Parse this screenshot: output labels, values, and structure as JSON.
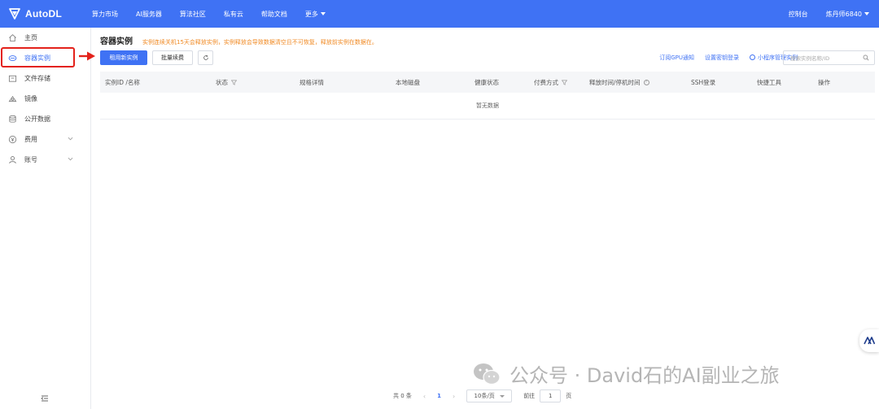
{
  "app": {
    "logo_text": "AutoDL"
  },
  "topnav": {
    "items": [
      "算力市场",
      "AI服务器",
      "算法社区",
      "私有云",
      "帮助文档"
    ],
    "more_label": "更多",
    "console_label": "控制台",
    "user_label": "炼丹师6840"
  },
  "sidebar": {
    "items": [
      {
        "label": "主页",
        "icon": "home-icon"
      },
      {
        "label": "容器实例",
        "icon": "container-icon",
        "active": true
      },
      {
        "label": "文件存储",
        "icon": "folder-icon"
      },
      {
        "label": "镜像",
        "icon": "image-icon"
      },
      {
        "label": "公开数据",
        "icon": "database-icon"
      },
      {
        "label": "费用",
        "icon": "yen-icon"
      },
      {
        "label": "账号",
        "icon": "user-icon"
      }
    ]
  },
  "page": {
    "title": "容器实例",
    "warning": "实例连续关机15天会释放实例，实例释放会导致数据清空且不可恢复，释放前实例在数据在。"
  },
  "toolbar": {
    "rent_label": "租用新实例",
    "batch_label": "批量续费",
    "links": [
      "订阅GPU通知",
      "设置密钥登录",
      "小程序管理实例"
    ],
    "search_placeholder": "搜索实例名称/ID"
  },
  "table": {
    "columns": [
      "实例ID /名称",
      "状态",
      "规格详情",
      "本地磁盘",
      "健康状态",
      "付费方式",
      "释放时间/停机时间",
      "SSH登录",
      "快捷工具",
      "操作"
    ],
    "empty_text": "暂无数据"
  },
  "pagination": {
    "total_label": "共 0 条",
    "current_page": "1",
    "page_size": "10条/页",
    "goto_label": "前往",
    "goto_value": "1",
    "page_suffix": "页"
  },
  "watermark": {
    "text": "公众号 · David石的AI副业之旅"
  },
  "colors": {
    "primary": "#3f72f4",
    "warning": "#f08a24",
    "highlight": "#e3221b"
  }
}
